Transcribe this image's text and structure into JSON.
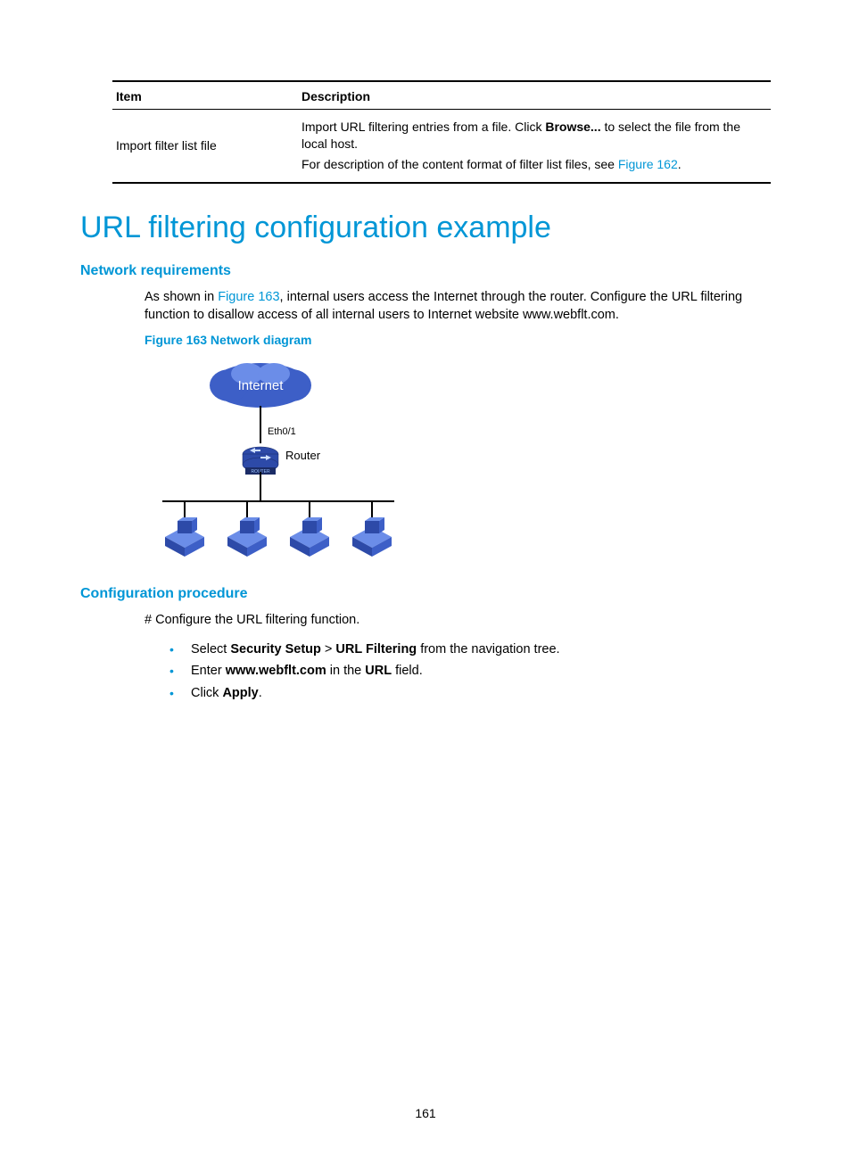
{
  "table": {
    "headers": [
      "Item",
      "Description"
    ],
    "row": {
      "item": "Import filter list file",
      "desc_line1_a": "Import URL filtering entries from a file. Click ",
      "desc_line1_bold": "Browse...",
      "desc_line1_b": " to select the file from the local host.",
      "desc_line2_a": "For description of the content format of filter list files, see ",
      "desc_line2_link": "Figure 162",
      "desc_line2_b": "."
    }
  },
  "section_title": "URL filtering configuration example",
  "network_req": {
    "heading": "Network requirements",
    "para_a": "As shown in ",
    "para_link": "Figure 163",
    "para_b": ", internal users access the Internet through the router. Configure the URL filtering function to disallow access of all internal users to Internet website www.webflt.com."
  },
  "figure_caption": "Figure 163 Network diagram",
  "diagram": {
    "cloud_label": "Internet",
    "interface_label": "Eth0/1",
    "router_label": "Router",
    "router_tag": "ROUTER"
  },
  "config_proc": {
    "heading": "Configuration procedure",
    "intro": "# Configure the URL filtering function.",
    "bullets": [
      {
        "a": "Select ",
        "b1": "Security Setup",
        "mid": " > ",
        "b2": "URL Filtering",
        "c": " from the navigation tree."
      },
      {
        "a": "Enter ",
        "b1": "www.webflt.com",
        "mid": " in the ",
        "b2": "URL",
        "c": " field."
      },
      {
        "a": "Click ",
        "b1": "Apply",
        "mid": "",
        "b2": "",
        "c": "."
      }
    ]
  },
  "page_number": "161"
}
